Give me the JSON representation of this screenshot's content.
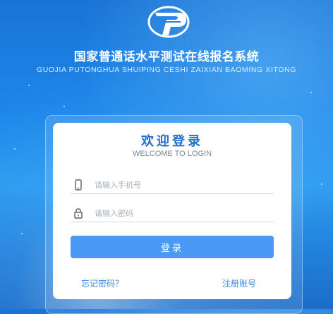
{
  "header": {
    "title": "国家普通话水平测试在线报名系统",
    "subtitle": "GUOJIA PUTONGHUA SHUIPING CESHI ZAIXIAN BAOMING XITONG",
    "logo_icon": "putonghua-test-logo"
  },
  "login": {
    "title": "欢迎登录",
    "subtitle": "WELCOME TO LOGIN",
    "phone": {
      "placeholder": "请输入手机号",
      "value": "",
      "icon": "phone-icon"
    },
    "password": {
      "placeholder": "请输入密码",
      "value": "",
      "icon": "lock-icon"
    },
    "submit_label": "登录",
    "forgot_label": "忘记密码？",
    "register_label": "注册账号"
  },
  "colors": {
    "accent": "#4a9af5",
    "title_blue": "#1f6fce",
    "link_blue": "#3c8be6",
    "background": "#1c86e8"
  }
}
